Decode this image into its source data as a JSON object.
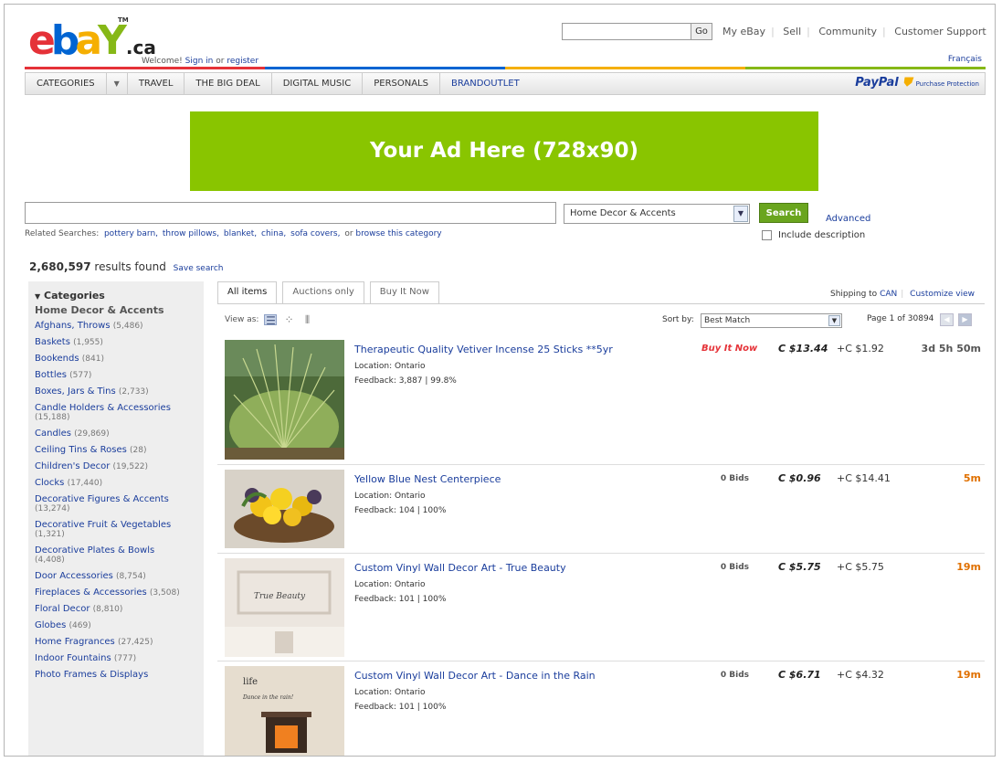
{
  "header": {
    "logo_text": "ebay",
    "logo_tld": ".ca",
    "trademark": "TM",
    "welcome_prefix": "Welcome!",
    "sign_in": "Sign in",
    "or_text": "or",
    "register": "register",
    "go_label": "Go",
    "top_links": [
      "My eBay",
      "Sell",
      "Community",
      "Customer Support"
    ],
    "francais": "Français",
    "nav_items": [
      "CATEGORIES",
      "TRAVEL",
      "THE BIG DEAL",
      "DIGITAL MUSIC",
      "PERSONALS"
    ],
    "brand_outlet_bold": "BRAND",
    "brand_outlet_rest": "OUTLET",
    "paypal": "PayPal",
    "paypal_tag": "Purchase Protection"
  },
  "ad": {
    "text": "Your Ad Here (728x90)",
    "color": "#89c500"
  },
  "search": {
    "category": "Home Decor & Accents",
    "button": "Search",
    "advanced": "Advanced",
    "include_description": "Include description",
    "related_label": "Related Searches:",
    "related": [
      "pottery barn,",
      "throw pillows,",
      "blanket,",
      "china,",
      "sofa covers,"
    ],
    "or_browse": "or",
    "browse": "browse this category"
  },
  "results": {
    "count": "2,680,597",
    "label": "results found",
    "save": "Save search"
  },
  "sidebar": {
    "heading": "Categories",
    "current": "Home Decor & Accents",
    "items": [
      {
        "name": "Afghans, Throws",
        "count": "(5,486)"
      },
      {
        "name": "Baskets",
        "count": "(1,955)"
      },
      {
        "name": "Bookends",
        "count": "(841)"
      },
      {
        "name": "Bottles",
        "count": "(577)"
      },
      {
        "name": "Boxes, Jars & Tins",
        "count": "(2,733)"
      },
      {
        "name": "Candle Holders & Accessories",
        "count": "(15,188)"
      },
      {
        "name": "Candles",
        "count": "(29,869)"
      },
      {
        "name": "Ceiling Tins & Roses",
        "count": "(28)"
      },
      {
        "name": "Children's Decor",
        "count": "(19,522)"
      },
      {
        "name": "Clocks",
        "count": "(17,440)"
      },
      {
        "name": "Decorative Figures & Accents",
        "count": "(13,274)"
      },
      {
        "name": "Decorative Fruit & Vegetables",
        "count": "(1,321)"
      },
      {
        "name": "Decorative Plates & Bowls",
        "count": "(4,408)"
      },
      {
        "name": "Door Accessories",
        "count": "(8,754)"
      },
      {
        "name": "Fireplaces & Accessories",
        "count": "(3,508)"
      },
      {
        "name": "Floral Decor",
        "count": "(8,810)"
      },
      {
        "name": "Globes",
        "count": "(469)"
      },
      {
        "name": "Home Fragrances",
        "count": "(27,425)"
      },
      {
        "name": "Indoor Fountains",
        "count": "(777)"
      },
      {
        "name": "Photo Frames & Displays",
        "count": ""
      }
    ]
  },
  "tabs": [
    "All items",
    "Auctions only",
    "Buy It Now"
  ],
  "toolbar": {
    "shipping_to": "Shipping to",
    "country": "CAN",
    "customize": "Customize view",
    "view_as": "View as:",
    "sort_by": "Sort by:",
    "sort_value": "Best Match",
    "page_info": "Page 1 of 30894"
  },
  "listings": [
    {
      "title": "Therapeutic Quality Vetiver Incense 25 Sticks **5yr",
      "location": "Location: Ontario",
      "feedback": "Feedback: 3,887 |  99.8%",
      "format": "Buy It Now",
      "bids": "",
      "price": "C $13.44",
      "shipping": "+C $1.92",
      "time": "3d 5h 50m",
      "time_color": "#555555"
    },
    {
      "title": "Yellow Blue Nest Centerpiece",
      "location": "Location: Ontario",
      "feedback": "Feedback: 104 |  100%",
      "format": "",
      "bids": "0 Bids",
      "price": "C $0.96",
      "shipping": "+C $14.41",
      "time": "5m",
      "time_color": "#e07000"
    },
    {
      "title": "Custom Vinyl Wall Decor Art - True Beauty",
      "location": "Location: Ontario",
      "feedback": "Feedback: 101 |  100%",
      "format": "",
      "bids": "0 Bids",
      "price": "C $5.75",
      "shipping": "+C $5.75",
      "time": "19m",
      "time_color": "#e07000"
    },
    {
      "title": "Custom Vinyl Wall Decor Art - Dance in the Rain",
      "location": "Location: Ontario",
      "feedback": "Feedback: 101 |  100%",
      "format": "",
      "bids": "0 Bids",
      "price": "C $6.71",
      "shipping": "+C $4.32",
      "time": "19m",
      "time_color": "#e07000"
    }
  ],
  "listing_images": {
    "img3_text": "True Beauty",
    "img4_text_1": "life",
    "img4_text_2": "Dance in the rain!"
  }
}
